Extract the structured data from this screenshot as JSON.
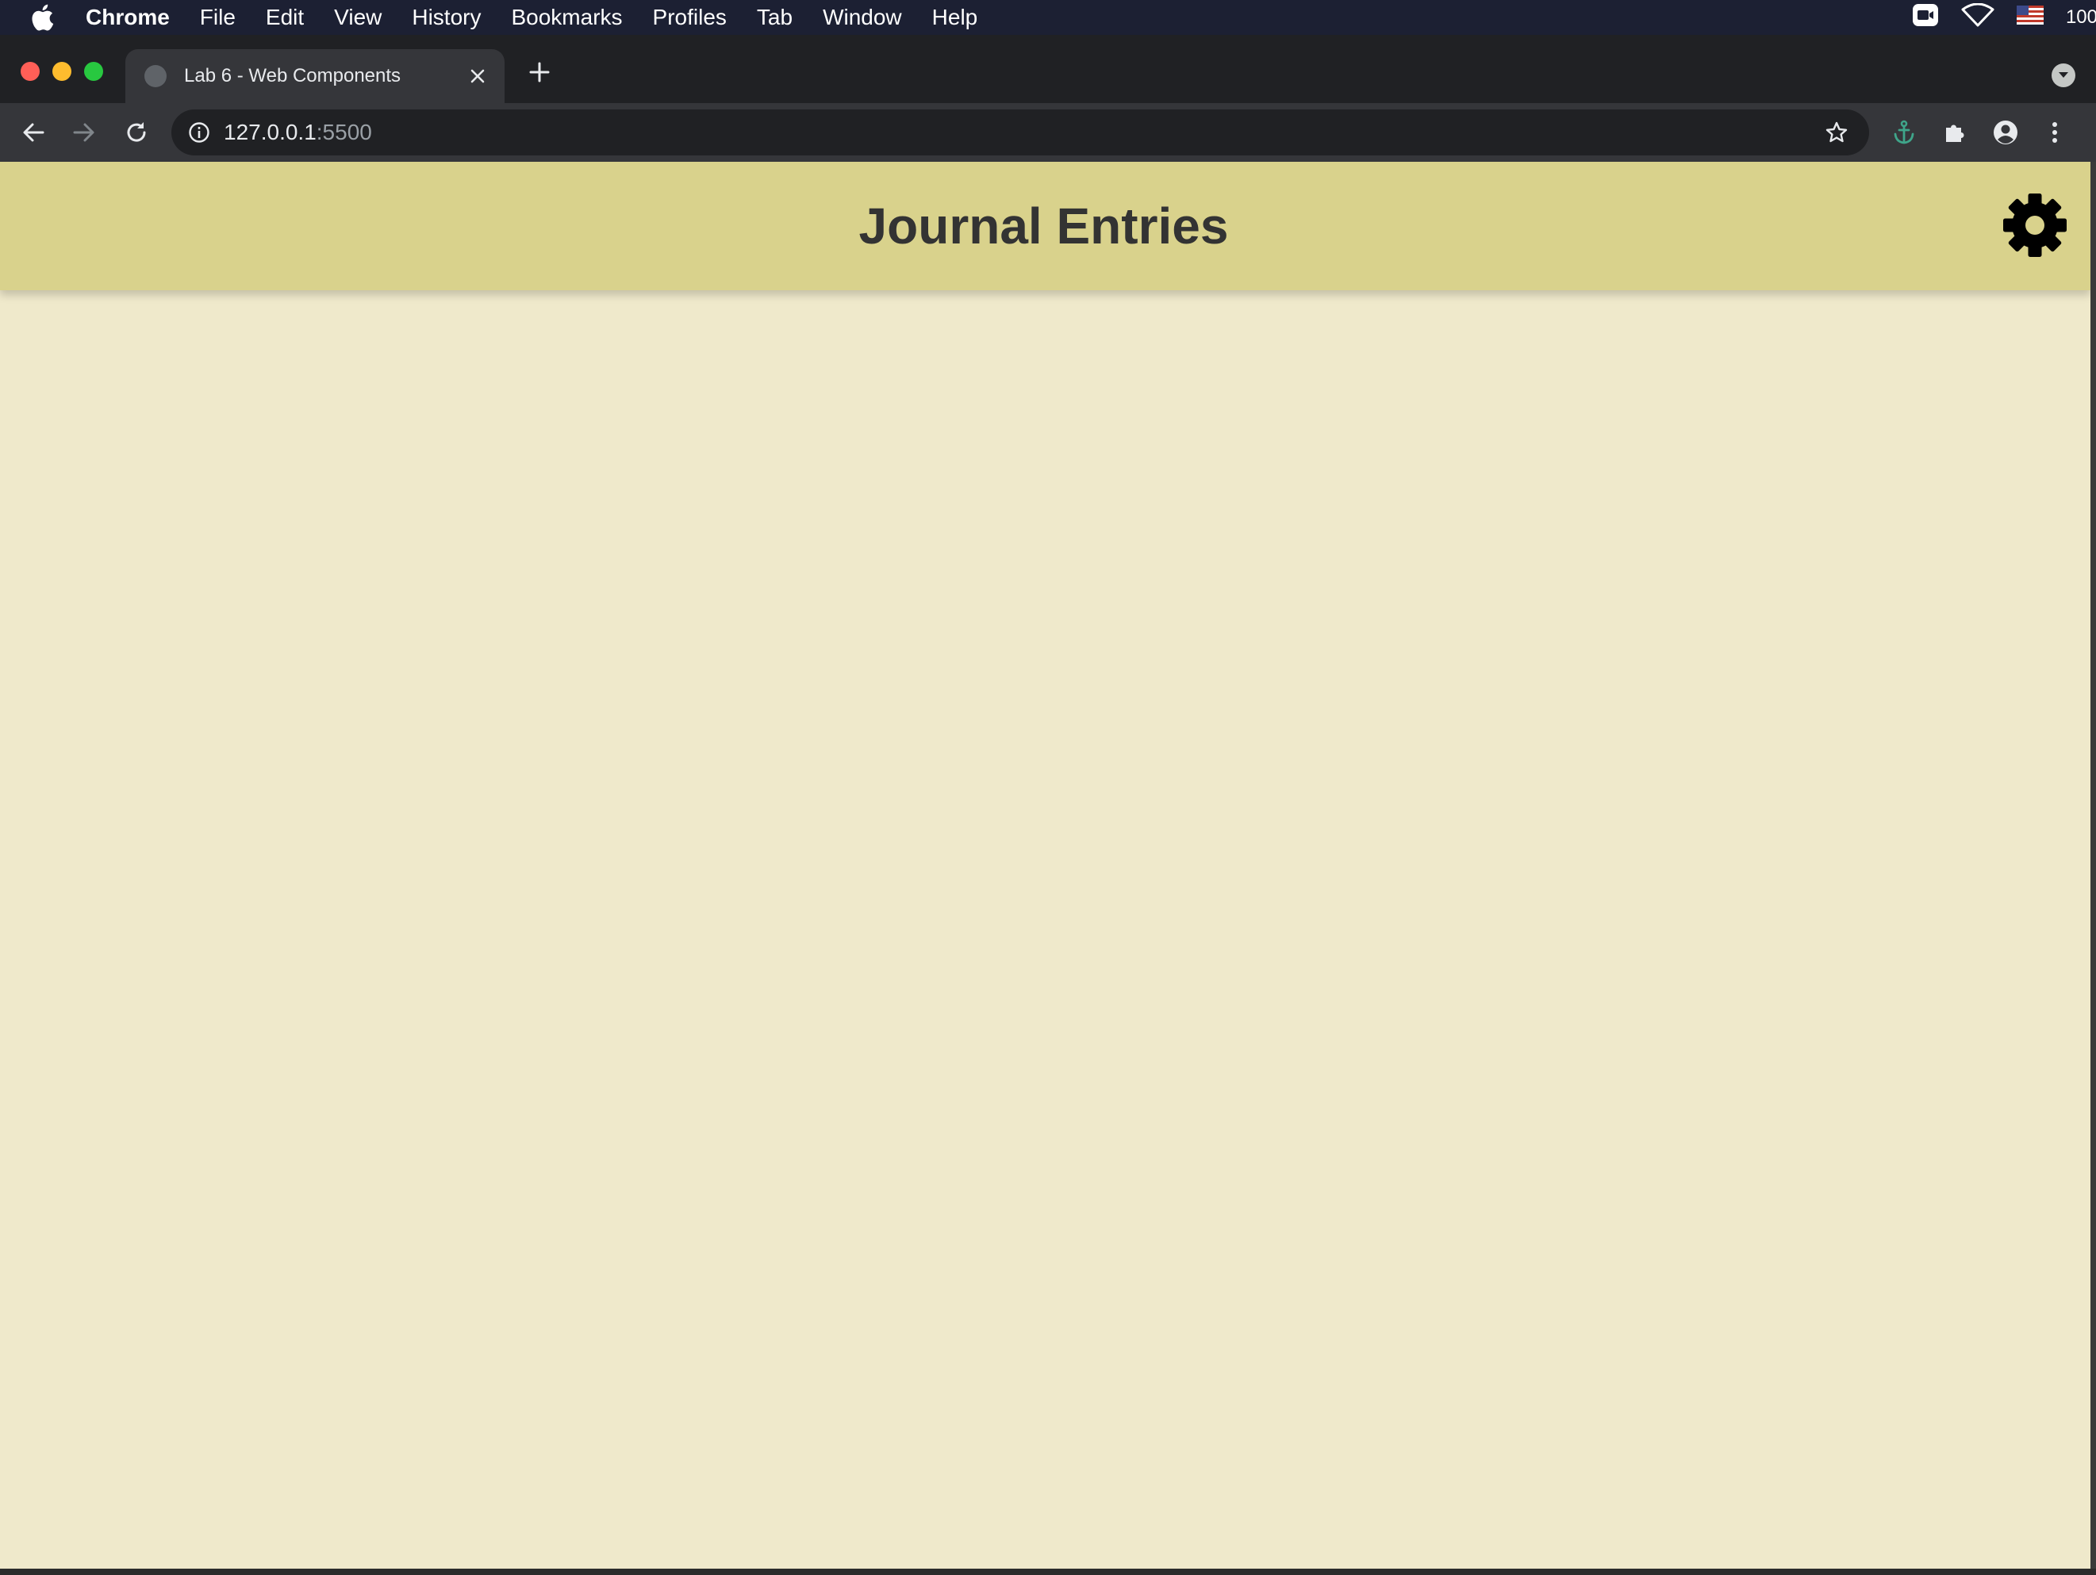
{
  "menubar": {
    "app_name": "Chrome",
    "items": [
      "File",
      "Edit",
      "View",
      "History",
      "Bookmarks",
      "Profiles",
      "Tab",
      "Window",
      "Help"
    ],
    "battery_text": "100"
  },
  "browser": {
    "tab_title": "Lab 6 - Web Components",
    "url_host": "127.0.0.1",
    "url_port": ":5500"
  },
  "page": {
    "title": "Journal Entries",
    "background_color": "#efe9cb",
    "header_color": "#d9d28c"
  },
  "icons": {
    "settings": "gear-icon"
  }
}
